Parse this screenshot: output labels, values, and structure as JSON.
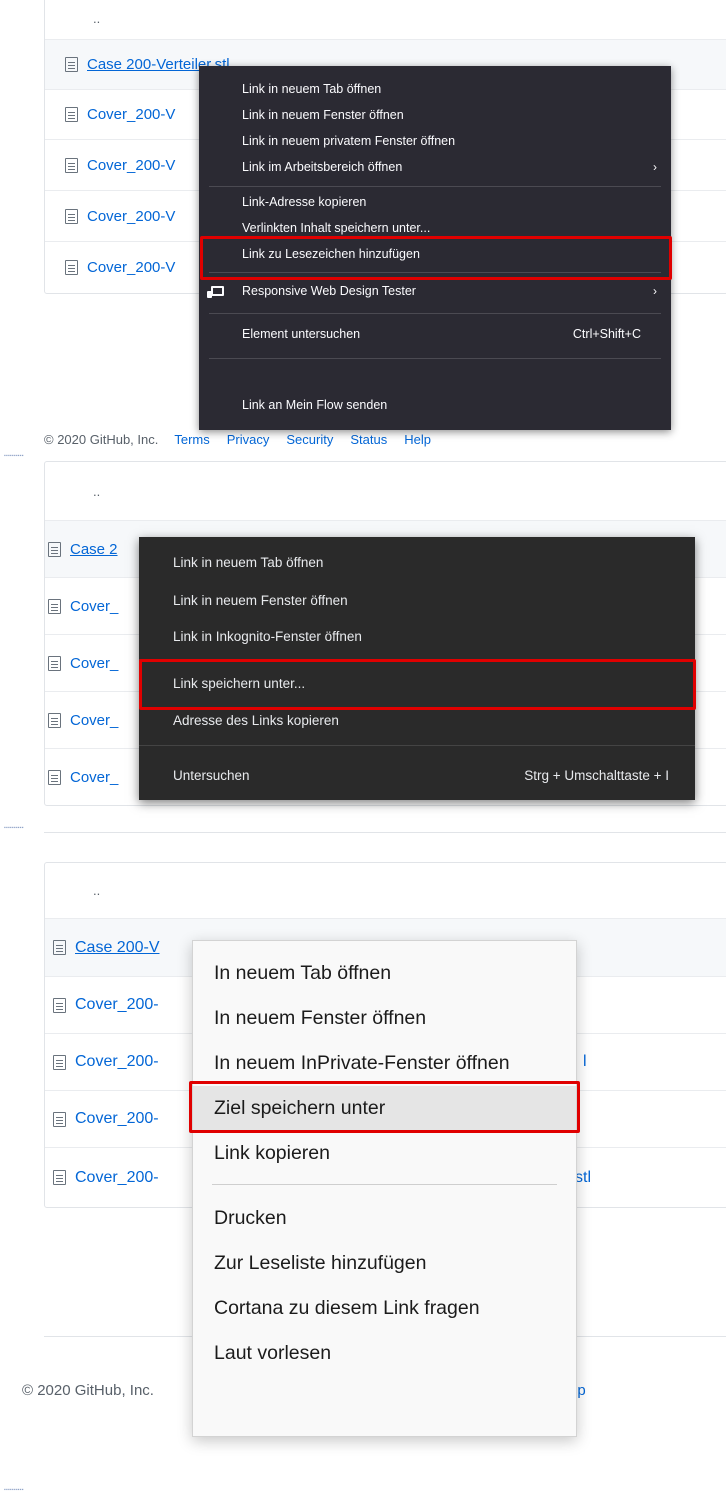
{
  "panel1": {
    "parent_dir": "..",
    "files": [
      "Case 200-Verteiler.stl",
      "Cover_200-V",
      "Cover_200-V",
      "Cover_200-V",
      "Cover_200-V"
    ],
    "footer": {
      "copyright": "© 2020 GitHub, Inc.",
      "links": [
        "Terms",
        "Privacy",
        "Security",
        "Status",
        "Help"
      ]
    },
    "menu": {
      "items": [
        "Link in neuem Tab öffnen",
        "Link in neuem Fenster öffnen",
        "Link in neuem privatem Fenster öffnen",
        "Link im Arbeitsbereich öffnen",
        "Link-Adresse kopieren",
        "Verlinkten Inhalt speichern unter...",
        "Link zu Lesezeichen hinzufügen",
        "Responsive Web Design Tester",
        "Element untersuchen",
        "Link an Mein Flow senden"
      ],
      "shortcut": "Ctrl+Shift+C",
      "submenu_arrow": "›",
      "highlighted": "Verlinkten Inhalt speichern unter..."
    }
  },
  "panel2": {
    "parent_dir": "..",
    "files": [
      "Case 2",
      "Cover_",
      "Cover_",
      "Cover_",
      "Cover_"
    ],
    "menu": {
      "items": [
        "Link in neuem Tab öffnen",
        "Link in neuem Fenster öffnen",
        "Link in Inkognito-Fenster öffnen",
        "Link speichern unter...",
        "Adresse des Links kopieren",
        "Untersuchen"
      ],
      "shortcut": "Strg + Umschalttaste + I",
      "highlighted": "Link speichern unter..."
    }
  },
  "panel3": {
    "parent_dir": "..",
    "files": [
      "Case 200-V",
      "Cover_200-",
      "Cover_200-",
      "Cover_200-",
      "Cover_200-"
    ],
    "tails": [
      "l",
      "stl"
    ],
    "footer": {
      "copyright": "© 2020 GitHub, Inc.",
      "help_tail": "lp"
    },
    "menu": {
      "items": [
        "In neuem Tab öffnen",
        "In neuem Fenster öffnen",
        "In neuem InPrivate-Fenster öffnen",
        "Ziel speichern unter",
        "Link kopieren",
        "Drucken",
        "Zur Leseliste hinzufügen",
        "Cortana zu diesem Link fragen",
        "Laut vorlesen"
      ],
      "highlighted": "Ziel speichern unter"
    }
  },
  "colors": {
    "highlight_box": "#e00000",
    "link": "#0366d6",
    "dark_menu_bg": "#2b2a33",
    "light_menu_bg": "#f9f9f9"
  }
}
